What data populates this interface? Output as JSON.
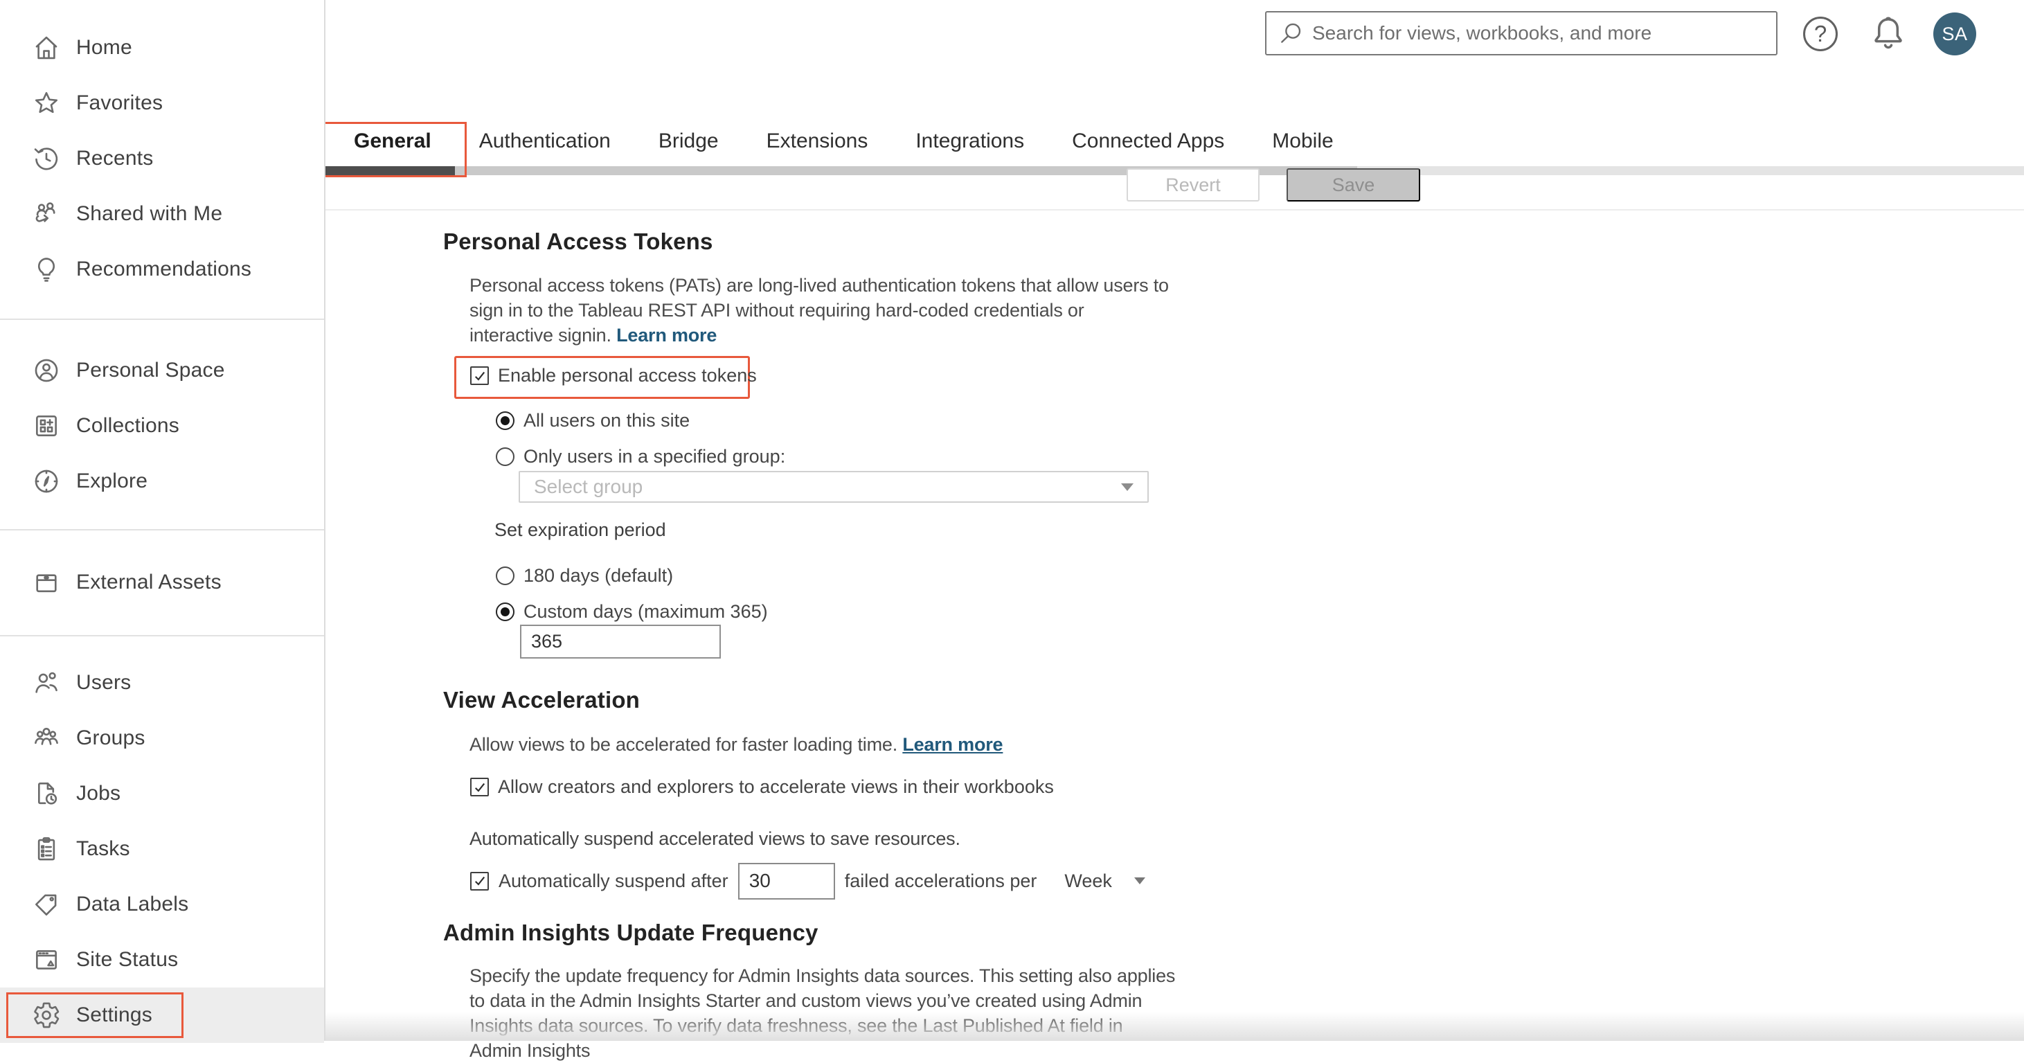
{
  "topbar": {
    "search_placeholder": "Search for views, workbooks, and more",
    "help_glyph": "?",
    "avatar_initials": "SA"
  },
  "sidebar": {
    "items": [
      "Home",
      "Favorites",
      "Recents",
      "Shared with Me",
      "Recommendations",
      "Personal Space",
      "Collections",
      "Explore",
      "External Assets",
      "Users",
      "Groups",
      "Jobs",
      "Tasks",
      "Data Labels",
      "Site Status",
      "Settings"
    ],
    "selected": "Settings"
  },
  "tabs": {
    "items": [
      "General",
      "Authentication",
      "Bridge",
      "Extensions",
      "Integrations",
      "Connected Apps",
      "Mobile"
    ],
    "active": "General"
  },
  "actions": {
    "revert": "Revert",
    "save": "Save"
  },
  "pat": {
    "heading": "Personal Access Tokens",
    "desc": "Personal access tokens (PATs) are long-lived authentication tokens that allow users to sign in to the Tableau REST API without requiring hard-coded credentials or interactive signin.",
    "learn_more": "Learn more",
    "enable_label": "Enable personal access tokens",
    "enabled": true,
    "all_users_label": "All users on this site",
    "all_users_selected": true,
    "group_label": "Only users in a specified group:",
    "group_selected": false,
    "select_placeholder": "Select group",
    "expiration_label": "Set expiration period",
    "days180_label": "180 days (default)",
    "days180_selected": false,
    "custom_label": "Custom days (maximum 365)",
    "custom_selected": true,
    "custom_value": "365"
  },
  "accel": {
    "heading": "View Acceleration",
    "desc": "Allow views to be accelerated for faster loading time.",
    "learn_more": "Learn more",
    "allow_label": "Allow creators and explorers to accelerate views in their workbooks",
    "allow_checked": true,
    "suspend_desc": "Automatically suspend accelerated views to save resources.",
    "suspend_before": "Automatically suspend after",
    "suspend_checked": true,
    "suspend_value": "30",
    "suspend_after": "failed accelerations per",
    "period_value": "Week"
  },
  "admin": {
    "heading": "Admin Insights Update Frequency",
    "desc": "Specify the update frequency for Admin Insights data sources. This setting also applies to data in the Admin Insights Starter and custom views you’ve created using Admin Insights data sources. To verify data freshness, see the Last Published At field in Admin Insights"
  },
  "colors": {
    "highlight_red": "#E8593C",
    "link_blue": "#21597B",
    "avatar_bg": "#3B6379",
    "active_tab_indicator": "#4E4E4E"
  }
}
